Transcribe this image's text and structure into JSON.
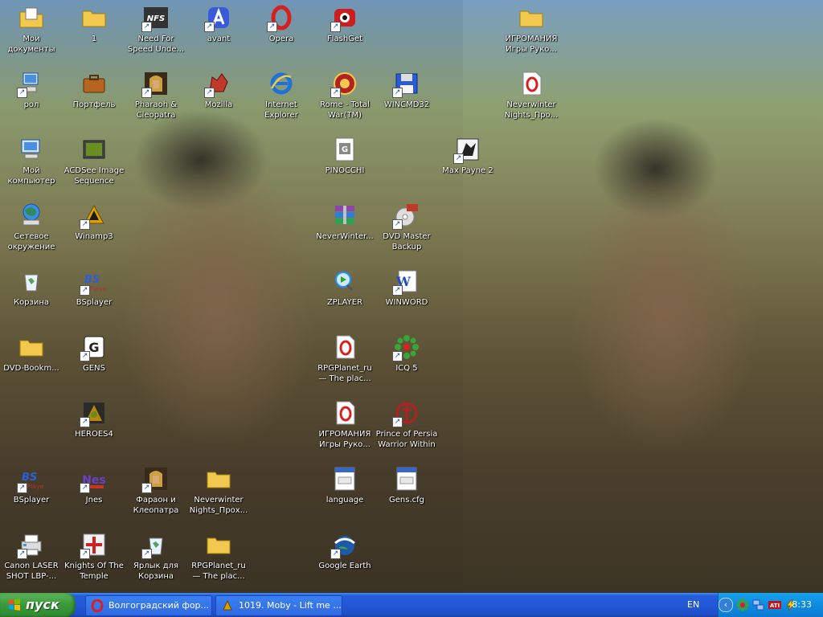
{
  "icons": [
    {
      "label": "Мои документы",
      "glyph": "my-documents",
      "color": "#f2c94c",
      "shortcut": false
    },
    {
      "label": "1",
      "glyph": "folder",
      "color": "#f2c94c",
      "shortcut": false
    },
    {
      "label": "Need For Speed Unde...",
      "glyph": "nfs",
      "color": "#333333",
      "shortcut": true
    },
    {
      "label": "avant",
      "glyph": "avant",
      "color": "#3a5ad9",
      "shortcut": true
    },
    {
      "label": "Opera",
      "glyph": "opera",
      "color": "#d62020",
      "shortcut": true
    },
    {
      "label": "FlashGet",
      "glyph": "flashget",
      "color": "#cc1e1e",
      "shortcut": true
    },
    {
      "label": "рол",
      "glyph": "network-pc",
      "color": "#4a90e2",
      "shortcut": true
    },
    {
      "label": "Портфель",
      "glyph": "briefcase",
      "color": "#b5651d",
      "shortcut": false
    },
    {
      "label": "Pharaoh & Cleopatra",
      "glyph": "pharaoh",
      "color": "#caa040",
      "shortcut": true
    },
    {
      "label": "Mozilla",
      "glyph": "mozilla",
      "color": "#c0392b",
      "shortcut": true
    },
    {
      "label": "Internet Explorer",
      "glyph": "ie",
      "color": "#1e73d8",
      "shortcut": false
    },
    {
      "label": "Rome - Total War(TM)",
      "glyph": "rome",
      "color": "#b22222",
      "shortcut": true
    },
    {
      "label": "WINCMD32",
      "glyph": "wincmd",
      "color": "#2a5bd6",
      "shortcut": true
    },
    {
      "label": "Мой компьютер",
      "glyph": "my-computer",
      "color": "#4a90e2",
      "shortcut": false
    },
    {
      "label": "ACDSee Image Sequence",
      "glyph": "acdsee",
      "color": "#6b8e23",
      "shortcut": false
    },
    {
      "label": "PINOCCHI",
      "glyph": "pinocchi",
      "color": "#888888",
      "shortcut": false
    },
    {
      "label": "Сетевое окружение",
      "glyph": "network",
      "color": "#2e8b57",
      "shortcut": false
    },
    {
      "label": "Winamp3",
      "glyph": "winamp",
      "color": "#e0a000",
      "shortcut": true
    },
    {
      "label": "NeverWinter...",
      "glyph": "winrar",
      "color": "#8e44ad",
      "shortcut": false
    },
    {
      "label": "DVD Master Backup",
      "glyph": "dvd",
      "color": "#c0392b",
      "shortcut": true
    },
    {
      "label": "Корзина",
      "glyph": "recycle",
      "color": "#5aa05a",
      "shortcut": false
    },
    {
      "label": "BSplayer",
      "glyph": "bsplayer",
      "color": "#2c5ed8",
      "shortcut": true
    },
    {
      "label": "ZPLAYER",
      "glyph": "zplayer",
      "color": "#1e90ff",
      "shortcut": false
    },
    {
      "label": "WINWORD",
      "glyph": "word",
      "color": "#1f4eb8",
      "shortcut": true
    },
    {
      "label": "DVD-Bookm...",
      "glyph": "folder",
      "color": "#f2c94c",
      "shortcut": false
    },
    {
      "label": "GENS",
      "glyph": "gens",
      "color": "#222222",
      "shortcut": true
    },
    {
      "label": "RPGPlanet_ru — The plac...",
      "glyph": "opera-doc",
      "color": "#d62020",
      "shortcut": false
    },
    {
      "label": "ICQ 5",
      "glyph": "icq",
      "color": "#3aa33a",
      "shortcut": true
    },
    {
      "label": "HEROES4",
      "glyph": "heroes",
      "color": "#b8860b",
      "shortcut": true
    },
    {
      "label": "ИГРОМАНИЯ Игры Руко...",
      "glyph": "opera-doc",
      "color": "#d62020",
      "shortcut": false
    },
    {
      "label": "Prince of Persia Warrior Within",
      "glyph": "prince",
      "color": "#b22222",
      "shortcut": true
    },
    {
      "label": "BSplayer",
      "glyph": "bsplayer",
      "color": "#2c5ed8",
      "shortcut": true
    },
    {
      "label": "Jnes",
      "glyph": "jnes",
      "color": "#6a3fc9",
      "shortcut": true
    },
    {
      "label": "Фараон и Клеопатра",
      "glyph": "pharaoh",
      "color": "#caa040",
      "shortcut": true
    },
    {
      "label": "Neverwinter Nights_Прох...",
      "glyph": "folder",
      "color": "#f2c94c",
      "shortcut": false
    },
    {
      "label": "language",
      "glyph": "ini-file",
      "color": "#3a66c8",
      "shortcut": false
    },
    {
      "label": "Gens.cfg",
      "glyph": "ini-file",
      "color": "#3a66c8",
      "shortcut": false
    },
    {
      "label": "Canon LASER SHOT LBP-...",
      "glyph": "printer",
      "color": "#4a90e2",
      "shortcut": true
    },
    {
      "label": "Knights Of The Temple",
      "glyph": "knights",
      "color": "#cc2222",
      "shortcut": true
    },
    {
      "label": "Ярлык для Корзина",
      "glyph": "recycle",
      "color": "#5aa05a",
      "shortcut": true
    },
    {
      "label": "RPGPlanet_ru — The plac...",
      "glyph": "folder",
      "color": "#f2c94c",
      "shortcut": false
    },
    {
      "label": "Google Earth",
      "glyph": "google-earth",
      "color": "#1e5aa8",
      "shortcut": true
    },
    {
      "label": "ИГРОМАНИЯ Игры Руко...",
      "glyph": "folder",
      "color": "#f2c94c",
      "shortcut": false
    },
    {
      "label": "Neverwinter Nights_Про...",
      "glyph": "opera-doc",
      "color": "#d62020",
      "shortcut": false
    },
    {
      "label": "Max Payne 2",
      "glyph": "maxpayne",
      "color": "#222222",
      "shortcut": true
    }
  ],
  "taskbar": {
    "start_label": "пуск",
    "tasks": [
      {
        "label": "Волгоградский фор...",
        "glyph": "opera",
        "color": "#d62020"
      },
      {
        "label": "1019. Moby - Lift me ...",
        "glyph": "winamp",
        "color": "#e0a000"
      }
    ],
    "language": "EN",
    "clock": "8:33",
    "collapse_glyph": "‹"
  }
}
